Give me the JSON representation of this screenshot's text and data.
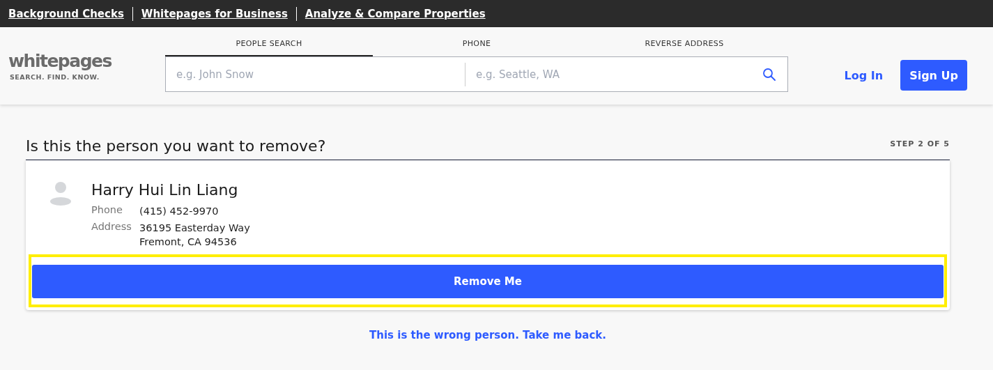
{
  "top_links": [
    "Background Checks",
    "Whitepages for Business",
    "Analyze & Compare Properties"
  ],
  "logo": {
    "name": "whitepages",
    "tagline": "SEARCH. FIND. KNOW."
  },
  "search_tabs": [
    {
      "label": "PEOPLE SEARCH",
      "selected": true
    },
    {
      "label": "PHONE",
      "selected": false
    },
    {
      "label": "REVERSE ADDRESS",
      "selected": false
    }
  ],
  "search": {
    "name_placeholder": "e.g. John Snow",
    "location_placeholder": "e.g. Seattle, WA"
  },
  "auth": {
    "login": "Log In",
    "signup": "Sign Up"
  },
  "page": {
    "heading": "Is this the person you want to remove?",
    "step": "STEP 2 OF 5"
  },
  "person": {
    "name": "Harry Hui Lin Liang",
    "details": [
      {
        "label": "Phone",
        "lines": [
          "(415) 452-9970"
        ]
      },
      {
        "label": "Address",
        "lines": [
          "36195 Easterday Way",
          "Fremont, CA 94536"
        ]
      }
    ]
  },
  "remove_button": {
    "label": "Remove Me",
    "highlighted": true
  },
  "back_link": "This is the wrong person. Take me back."
}
